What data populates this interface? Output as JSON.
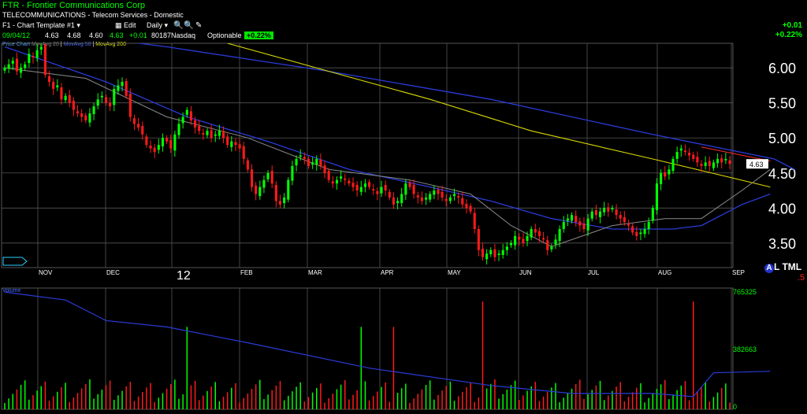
{
  "header": {
    "ticker_line": "FTR - Frontier Communications Corp",
    "industry_line": "TELECOMMUNICATIONS - Telecom Services - Domestic",
    "chart_template": "F1 - Chart Template #1",
    "edit_label": "Edit",
    "period_label": "Daily"
  },
  "quote": {
    "date": "09/04/12",
    "open": "4.63",
    "high": "4.68",
    "low": "4.60",
    "close": "4.63",
    "change": "+0.01",
    "volume": "80187",
    "exchange": "Nasdaq",
    "optionable": "Optionable",
    "change_pct": "+0.22%"
  },
  "right_panel": {
    "change": "+0.01",
    "change_pct": "+0.22%"
  },
  "legend": {
    "price_chart": "Price Chart",
    "ma20": "MovAvg 20",
    "ma50": "MovAvg 50",
    "ma200": "MovAvg 200"
  },
  "volume_label": "Volume",
  "extras": {
    "year_marker": "12",
    "al_a": "A",
    "al_text": "L TML",
    "red_five": ".5",
    "current_price_tag": "4.63"
  },
  "colors": {
    "up": "#00ff00",
    "down": "#ff1a1a",
    "ma20": "#8a8a8a",
    "ma50": "#2a3bd8",
    "ma200": "#d8d800",
    "grid": "#555555"
  },
  "chart_data": {
    "type": "candlestick",
    "ylim": [
      3.15,
      6.35
    ],
    "y_ticks": [
      "6.00",
      "5.50",
      "5.00",
      "4.50",
      "4.00",
      "3.50"
    ],
    "x_ticks": [
      "NOV",
      "DEC",
      "FEB",
      "MAR",
      "APR",
      "MAY",
      "JUN",
      "JUL",
      "AUG",
      "SEP"
    ],
    "closes": [
      6.0,
      6.05,
      6.1,
      5.95,
      6.0,
      6.05,
      6.2,
      6.15,
      6.25,
      6.3,
      5.9,
      5.8,
      5.7,
      5.75,
      5.55,
      5.6,
      5.5,
      5.4,
      5.35,
      5.3,
      5.25,
      5.35,
      5.45,
      5.55,
      5.6,
      5.5,
      5.45,
      5.7,
      5.75,
      5.8,
      5.6,
      5.3,
      5.2,
      5.15,
      5.05,
      4.9,
      4.85,
      4.8,
      4.9,
      5.0,
      4.95,
      4.85,
      5.05,
      5.2,
      5.3,
      5.4,
      5.25,
      5.15,
      5.1,
      5.05,
      5.1,
      5.0,
      5.05,
      5.1,
      5.0,
      4.9,
      4.95,
      4.9,
      4.85,
      4.7,
      4.55,
      4.3,
      4.2,
      4.3,
      4.4,
      4.5,
      4.35,
      4.1,
      4.05,
      4.15,
      4.4,
      4.6,
      4.7,
      4.75,
      4.7,
      4.6,
      4.65,
      4.7,
      4.6,
      4.5,
      4.4,
      4.35,
      4.4,
      4.45,
      4.4,
      4.35,
      4.3,
      4.25,
      4.3,
      4.35,
      4.3,
      4.25,
      4.2,
      4.3,
      4.25,
      4.15,
      4.05,
      4.1,
      4.2,
      4.35,
      4.3,
      4.2,
      4.15,
      4.1,
      4.15,
      4.2,
      4.25,
      4.2,
      4.15,
      4.1,
      4.15,
      4.2,
      4.15,
      4.05,
      4.0,
      3.95,
      3.7,
      3.4,
      3.3,
      3.35,
      3.4,
      3.3,
      3.35,
      3.4,
      3.45,
      3.5,
      3.6,
      3.55,
      3.5,
      3.6,
      3.7,
      3.65,
      3.6,
      3.55,
      3.4,
      3.45,
      3.55,
      3.7,
      3.8,
      3.85,
      3.9,
      3.8,
      3.75,
      3.7,
      3.85,
      3.95,
      3.9,
      3.95,
      4.0,
      3.95,
      4.0,
      3.9,
      3.85,
      3.8,
      3.75,
      3.65,
      3.6,
      3.65,
      3.7,
      3.8,
      4.0,
      4.35,
      4.5,
      4.45,
      4.55,
      4.7,
      4.8,
      4.85,
      4.8,
      4.75,
      4.7,
      4.65,
      4.6,
      4.65,
      4.6,
      4.65,
      4.7,
      4.65,
      4.7,
      4.63
    ],
    "moving_averages": {
      "ma20": [
        [
          0,
          6.0
        ],
        [
          20,
          5.85
        ],
        [
          40,
          5.3
        ],
        [
          60,
          5.0
        ],
        [
          80,
          4.55
        ],
        [
          100,
          4.4
        ],
        [
          115,
          4.2
        ],
        [
          125,
          3.75
        ],
        [
          135,
          3.45
        ],
        [
          150,
          3.75
        ],
        [
          163,
          3.85
        ],
        [
          172,
          3.85
        ],
        [
          182,
          4.25
        ],
        [
          189,
          4.55
        ]
      ],
      "ma50": [
        [
          0,
          6.3
        ],
        [
          25,
          5.8
        ],
        [
          45,
          5.3
        ],
        [
          65,
          4.95
        ],
        [
          85,
          4.55
        ],
        [
          105,
          4.3
        ],
        [
          120,
          4.1
        ],
        [
          135,
          3.85
        ],
        [
          150,
          3.7
        ],
        [
          165,
          3.7
        ],
        [
          172,
          3.75
        ],
        [
          182,
          4.05
        ],
        [
          189,
          4.2
        ]
      ],
      "ma200": [
        [
          55,
          6.35
        ],
        [
          80,
          5.95
        ],
        [
          105,
          5.55
        ],
        [
          130,
          5.1
        ],
        [
          160,
          4.7
        ],
        [
          189,
          4.3
        ]
      ],
      "long_blue": [
        [
          0,
          6.6
        ],
        [
          40,
          6.3
        ],
        [
          80,
          5.95
        ],
        [
          120,
          5.55
        ],
        [
          160,
          5.05
        ],
        [
          190,
          4.7
        ],
        [
          195,
          4.55
        ]
      ]
    },
    "trendline": [
      [
        172,
        4.87
      ],
      [
        189,
        4.67
      ]
    ],
    "volume_scale": [
      "765325",
      "382663",
      "0"
    ]
  }
}
